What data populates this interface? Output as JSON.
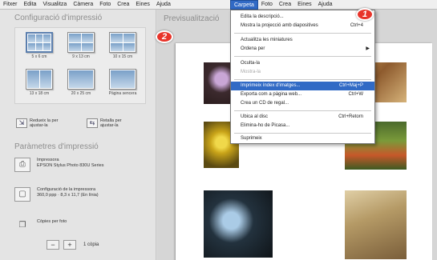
{
  "menubar": {
    "items": [
      "Fitxer",
      "Edita",
      "Visualitza",
      "Càmera",
      "Foto",
      "Crea",
      "Eines",
      "Ajuda"
    ],
    "open_menu": [
      "Carpeta",
      "Foto",
      "Crea",
      "Eines",
      "Ajuda"
    ]
  },
  "left_panel": {
    "config_title": "Configuració d'impressió",
    "sizes": [
      "5 x 6 cm",
      "9 x 13 cm",
      "10 x 15 cm",
      "13 x 18 cm",
      "20 x 25 cm",
      "Pàgina sencera"
    ],
    "fit_button": "Redueix la per ajustar-la",
    "crop_button": "Retalla per ajustar-la",
    "params_title": "Paràmetres d'impressió",
    "printer_label": "Impressora",
    "printer_value": "EPSON Stylus Photo 830U Series",
    "page_config_label": "Configuració de la impressora",
    "page_config_value": "360,0 ppp · 8,3 x 11,7 (En línia)",
    "copies_label": "Còpies per foto",
    "minus": "−",
    "plus": "+",
    "copies_value": "1 còpia"
  },
  "preview": {
    "title": "Previsualització"
  },
  "dropdown": {
    "items": [
      {
        "label": "Edita la descripció...",
        "shortcut": ""
      },
      {
        "label": "Mostra la projecció amb diapositives",
        "shortcut": "Ctrl+4"
      },
      {
        "label": "Actualitza les miniatures",
        "shortcut": ""
      },
      {
        "label": "Ordena per",
        "shortcut": ""
      },
      {
        "label": "Oculta-la",
        "shortcut": ""
      },
      {
        "label": "Mostra-la",
        "shortcut": ""
      },
      {
        "label": "Imprimeix índex d'imatges...",
        "shortcut": "Ctrl+Maj+P"
      },
      {
        "label": "Exporta com a pàgina web...",
        "shortcut": "Ctrl+W"
      },
      {
        "label": "Crea un CD de regal...",
        "shortcut": ""
      },
      {
        "label": "Ubica al disc",
        "shortcut": "Ctrl+Retorn"
      },
      {
        "label": "Elimina-ho de Picasa...",
        "shortcut": ""
      },
      {
        "label": "Suprimeix",
        "shortcut": ""
      }
    ]
  },
  "badges": {
    "one": "1",
    "two": "2"
  },
  "colors": {
    "highlight": "#316ac5",
    "badge": "#e8342a"
  }
}
